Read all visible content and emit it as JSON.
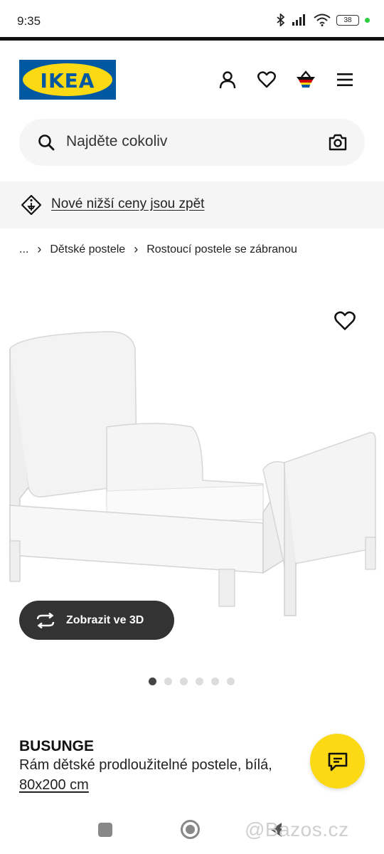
{
  "status_bar": {
    "time": "9:35",
    "battery": "38",
    "icons": [
      "bluetooth-icon",
      "signal-icon",
      "wifi-icon",
      "battery-icon"
    ]
  },
  "header": {
    "logo_text": "IKEA",
    "icons": [
      "user-icon",
      "heart-icon",
      "basket-icon",
      "menu-icon"
    ],
    "colors": {
      "brand_blue": "#0058a3",
      "brand_yellow": "#fbd914"
    }
  },
  "search": {
    "placeholder": "Najděte cokoliv"
  },
  "promo": {
    "text": "Nové nižší ceny jsou zpět"
  },
  "breadcrumb": {
    "items": [
      "...",
      "Dětské postele",
      "Rostoucí postele se zábranou"
    ]
  },
  "gallery": {
    "view3d_label": "Zobrazit ve 3D",
    "image_count": 6,
    "active_index": 0
  },
  "product": {
    "name": "BUSUNGE",
    "description": "Rám dětské prodloužitelné postele, bílá,",
    "size": "80x200 cm"
  },
  "watermark": "@Bazos.cz"
}
